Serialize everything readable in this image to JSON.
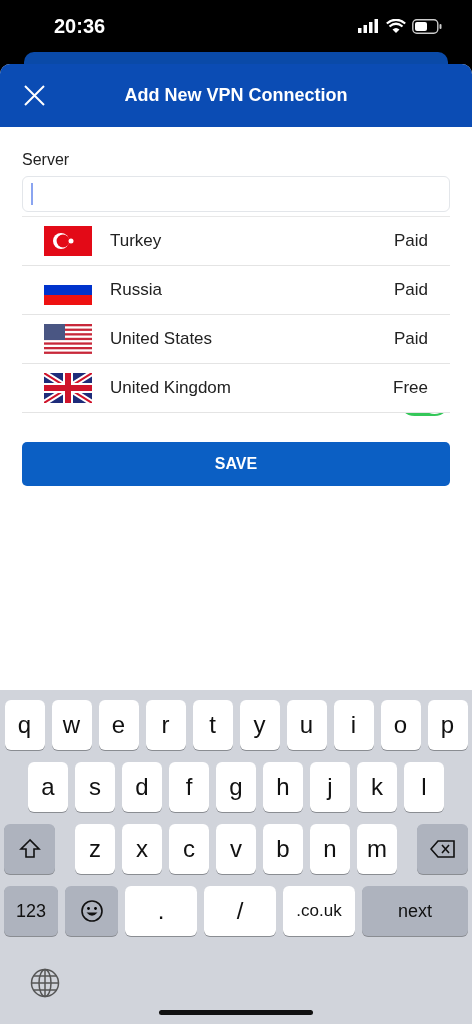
{
  "status_bar": {
    "time": "20:36"
  },
  "header": {
    "title": "Add New VPN Connection"
  },
  "form": {
    "label": "Server",
    "toggle": {
      "on": true
    },
    "servers": [
      {
        "name": "Turkey",
        "plan": "Paid",
        "kind": "tr"
      },
      {
        "name": "Russia",
        "plan": "Paid",
        "kind": "ru"
      },
      {
        "name": "United States",
        "plan": "Paid",
        "kind": "us"
      },
      {
        "name": "United Kingdom",
        "plan": "Free",
        "kind": "gb"
      }
    ],
    "save_button": "SAVE"
  },
  "keyboard": {
    "rows": [
      {
        "keys": [
          {
            "kind": "letter",
            "label": "q"
          },
          {
            "kind": "letter",
            "label": "w"
          },
          {
            "kind": "letter",
            "label": "e"
          },
          {
            "kind": "letter",
            "label": "r"
          },
          {
            "kind": "letter",
            "label": "t"
          },
          {
            "kind": "letter",
            "label": "y"
          },
          {
            "kind": "letter",
            "label": "u"
          },
          {
            "kind": "letter",
            "label": "i"
          },
          {
            "kind": "letter",
            "label": "o"
          },
          {
            "kind": "letter",
            "label": "p"
          }
        ]
      },
      {
        "keys": [
          {
            "kind": "letter",
            "label": "a"
          },
          {
            "kind": "letter",
            "label": "s"
          },
          {
            "kind": "letter",
            "label": "d"
          },
          {
            "kind": "letter",
            "label": "f"
          },
          {
            "kind": "letter",
            "label": "g"
          },
          {
            "kind": "letter",
            "label": "h"
          },
          {
            "kind": "letter",
            "label": "j"
          },
          {
            "kind": "letter",
            "label": "k"
          },
          {
            "kind": "letter",
            "label": "l"
          }
        ]
      },
      {
        "keys": [
          {
            "kind": "shift"
          },
          {
            "kind": "letter",
            "label": "z"
          },
          {
            "kind": "letter",
            "label": "x"
          },
          {
            "kind": "letter",
            "label": "c"
          },
          {
            "kind": "letter",
            "label": "v"
          },
          {
            "kind": "letter",
            "label": "b"
          },
          {
            "kind": "letter",
            "label": "n"
          },
          {
            "kind": "letter",
            "label": "m"
          },
          {
            "kind": "delete"
          }
        ]
      },
      {
        "keys": [
          {
            "kind": "mode",
            "label": "123"
          },
          {
            "kind": "emoji"
          },
          {
            "kind": "wide",
            "label": "."
          },
          {
            "kind": "wide",
            "label": "/"
          },
          {
            "kind": "wide",
            "label": ".co.uk"
          },
          {
            "kind": "action",
            "label": "next"
          }
        ]
      }
    ]
  }
}
